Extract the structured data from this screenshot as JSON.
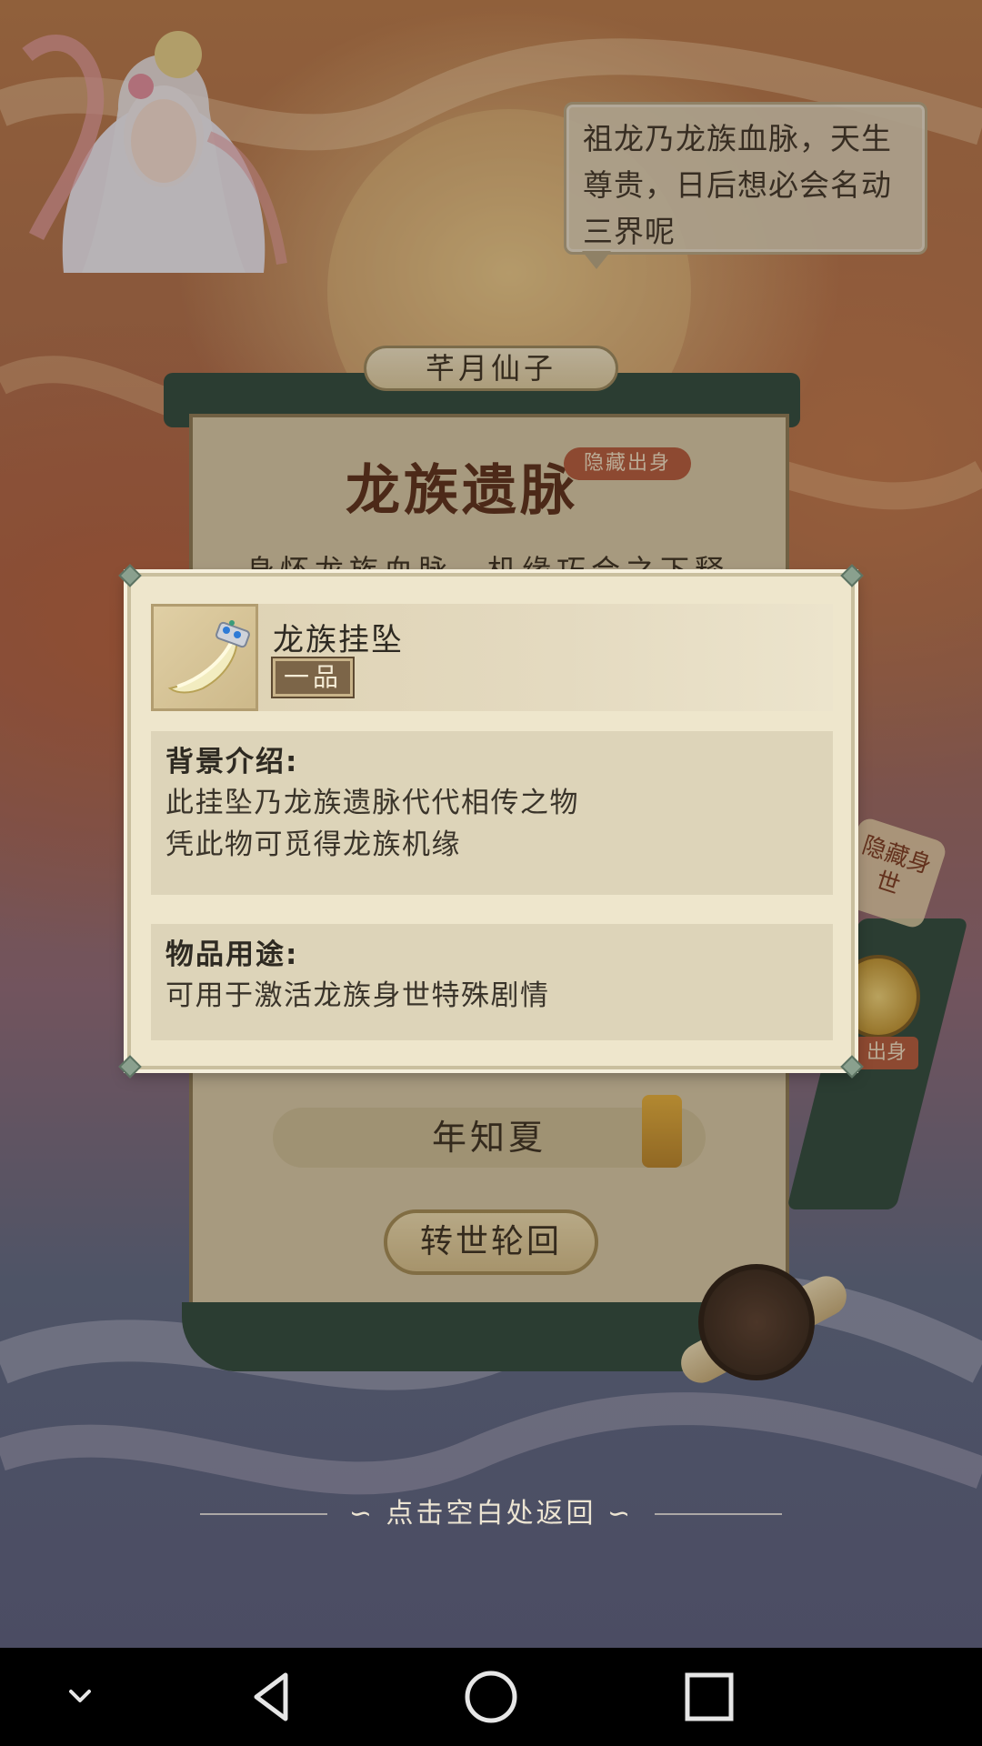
{
  "speech_bubble": {
    "lines": [
      "祖龙乃龙族血脉，天生",
      "尊贵，日后想必会名动",
      "三界呢"
    ]
  },
  "character_name": "芊月仙子",
  "background_panel": {
    "title": "龙族遗脉",
    "tag": "隐藏出身",
    "partial_text": "身怀龙族血脉，机缘巧合之下释",
    "player_name": "年知夏",
    "rebirth_button": "转世轮回",
    "side_badge": "隐藏身世",
    "side_tag": "出身"
  },
  "item_popup": {
    "name": "龙族挂坠",
    "grade": "一品",
    "background_section": {
      "title": "背景介绍:",
      "lines": [
        "此挂坠乃龙族遗脉代代相传之物",
        "凭此物可觅得龙族机缘"
      ]
    },
    "usage_section": {
      "title": "物品用途:",
      "lines": [
        "可用于激活龙族身世特殊剧情"
      ]
    }
  },
  "dismiss_hint": "点击空白处返回",
  "nav_bar": {
    "icons": [
      "chevron-down-icon",
      "back-icon",
      "home-icon",
      "recents-icon"
    ]
  },
  "colors": {
    "panel_green": "#2d4a3d",
    "popup_bg": "#eee6cc",
    "section_bg": "#ddd4b9",
    "grade_badge": "#7c6548",
    "tag_red": "#b55a3c"
  }
}
